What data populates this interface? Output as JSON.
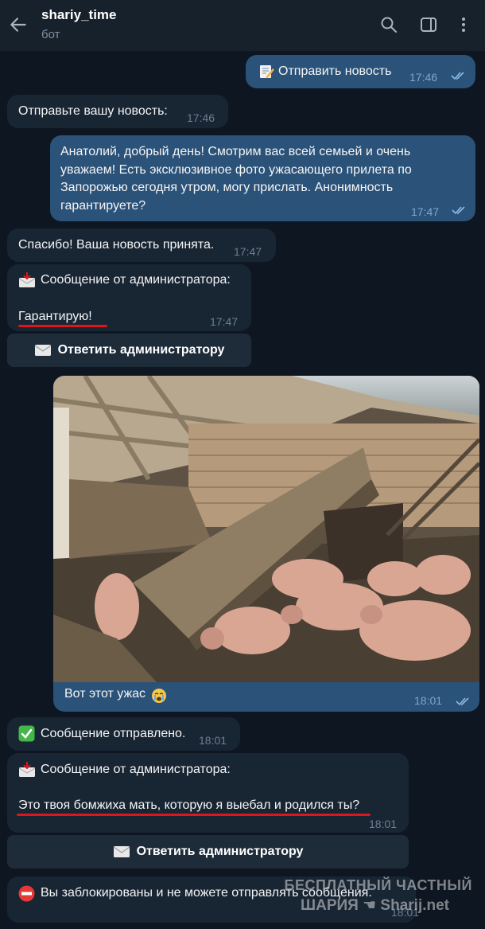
{
  "header": {
    "title": "shariy_time",
    "subtitle": "бот"
  },
  "messages": {
    "m1": {
      "text": "Отправить новость",
      "time": "17:46",
      "icon": "memo-emoji"
    },
    "m2": {
      "text": "Отправьте вашу новость:",
      "time": "17:46"
    },
    "m3": {
      "lines": [
        "Анатолий, добрый день! Смотрим вас всей семьей и очень",
        "уважаем! Есть эксклюзивное фото ужасающего прилета по",
        "Запорожью сегодня утром, могу прислать. Анонимность",
        "гарантируете?"
      ],
      "time": "17:47"
    },
    "m4": {
      "text": "Спасибо! Ваша новость принята.",
      "time": "17:47"
    },
    "m5": {
      "title": "Сообщение от администратора:",
      "text": "Гарантирую!",
      "time": "17:47",
      "icon": "incoming-envelope-emoji"
    },
    "m5_button": {
      "label": "Ответить администратору",
      "icon": "envelope-emoji"
    },
    "m6": {
      "caption": "Вот этот ужас",
      "time": "18:01",
      "emoji": "crying-face-emoji"
    },
    "m7": {
      "text": "Сообщение отправлено.",
      "time": "18:01",
      "icon": "check-mark-emoji"
    },
    "m8": {
      "title": "Сообщение от администратора:",
      "text": "Это твоя бомжиха мать, которую я выебал и родился ты?",
      "time": "18:01",
      "icon": "incoming-envelope-emoji"
    },
    "m8_button": {
      "label": "Ответить администратору",
      "icon": "envelope-emoji"
    },
    "m9": {
      "text": "Вы заблокированы и не можете отправлять сообщения.",
      "time": "18:01",
      "icon": "no-entry-emoji"
    }
  },
  "watermark": {
    "line1": "БЕСПЛАТНЫЙ ЧАСТНЫЙ",
    "line2a": "ШАРИЯ",
    "line2b": "Sharij.net"
  },
  "colors": {
    "background": "#0e1621",
    "header": "#17212b",
    "incoming": "#182533",
    "outgoing": "#2b5278",
    "highlight": "#e0151b"
  }
}
